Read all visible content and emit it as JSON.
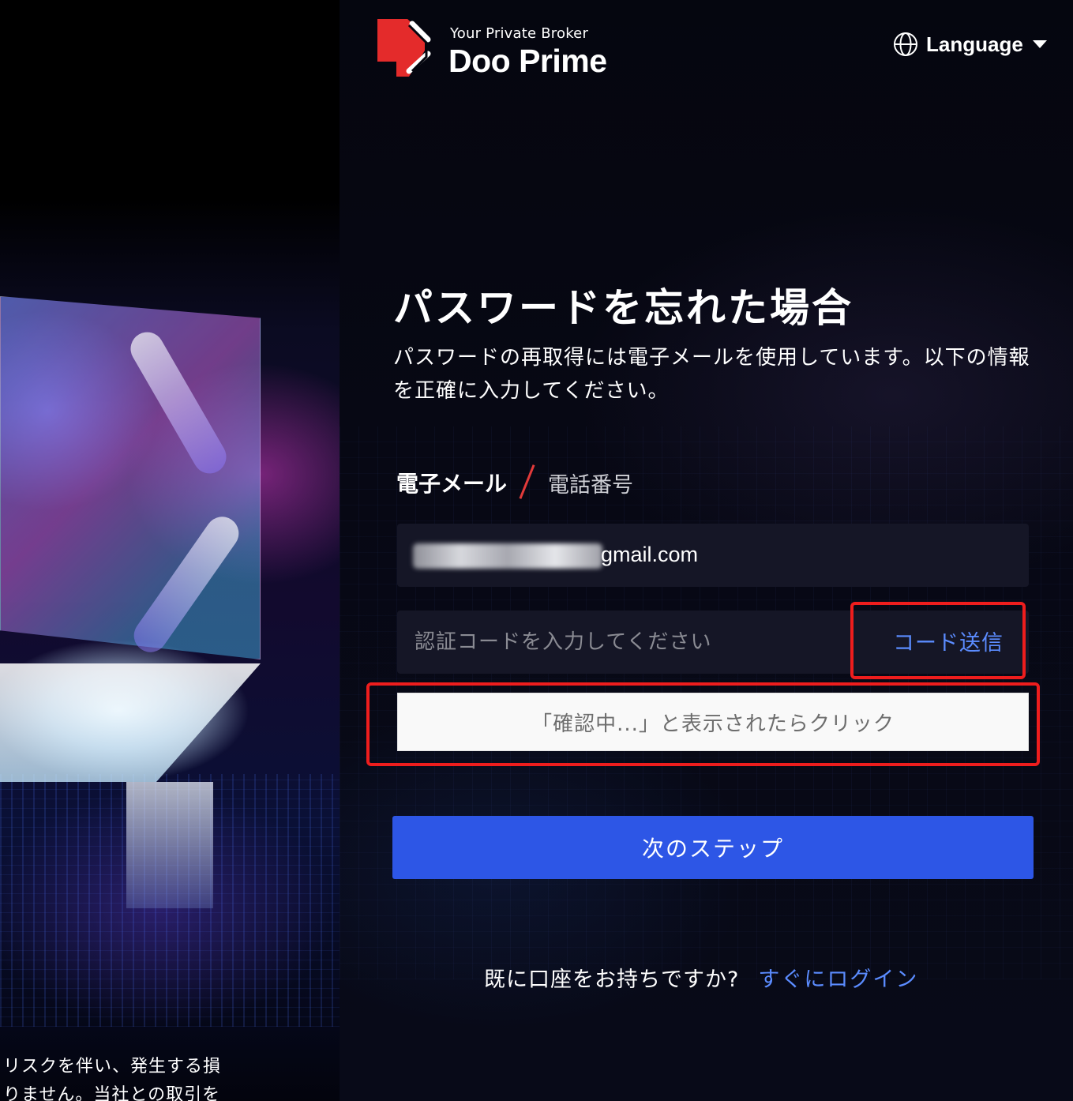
{
  "hero": {
    "disclaimer_lines": [
      "リスクを伴い、発生する損",
      "りません。当社との取引を"
    ]
  },
  "brand": {
    "tagline": "Your Private Broker",
    "name": "Doo Prime",
    "accent_color": "#E42B2B"
  },
  "language": {
    "label": "Language",
    "icon": "globe-icon"
  },
  "page": {
    "title": "パスワードを忘れた場合",
    "subtitle": "パスワードの再取得には電子メールを使用しています。以下の情報を正確に入力してください。"
  },
  "tabs": {
    "active": "電子メール",
    "inactive": "電話番号",
    "separator_color": "#E23A3A"
  },
  "form": {
    "email_suffix": "gmail.com",
    "code_placeholder": "認証コードを入力してください",
    "send_code_label": "コード送信",
    "captcha_label": "「確認中...」と表示されたらクリック",
    "next_label": "次のステップ",
    "primary_color": "#2D56E6",
    "link_color": "#5B8CFF"
  },
  "footer": {
    "question": "既に口座をお持ちですか?",
    "login_link": "すぐにログイン"
  },
  "annotations": {
    "highlight_color": "#EE1D1D"
  }
}
